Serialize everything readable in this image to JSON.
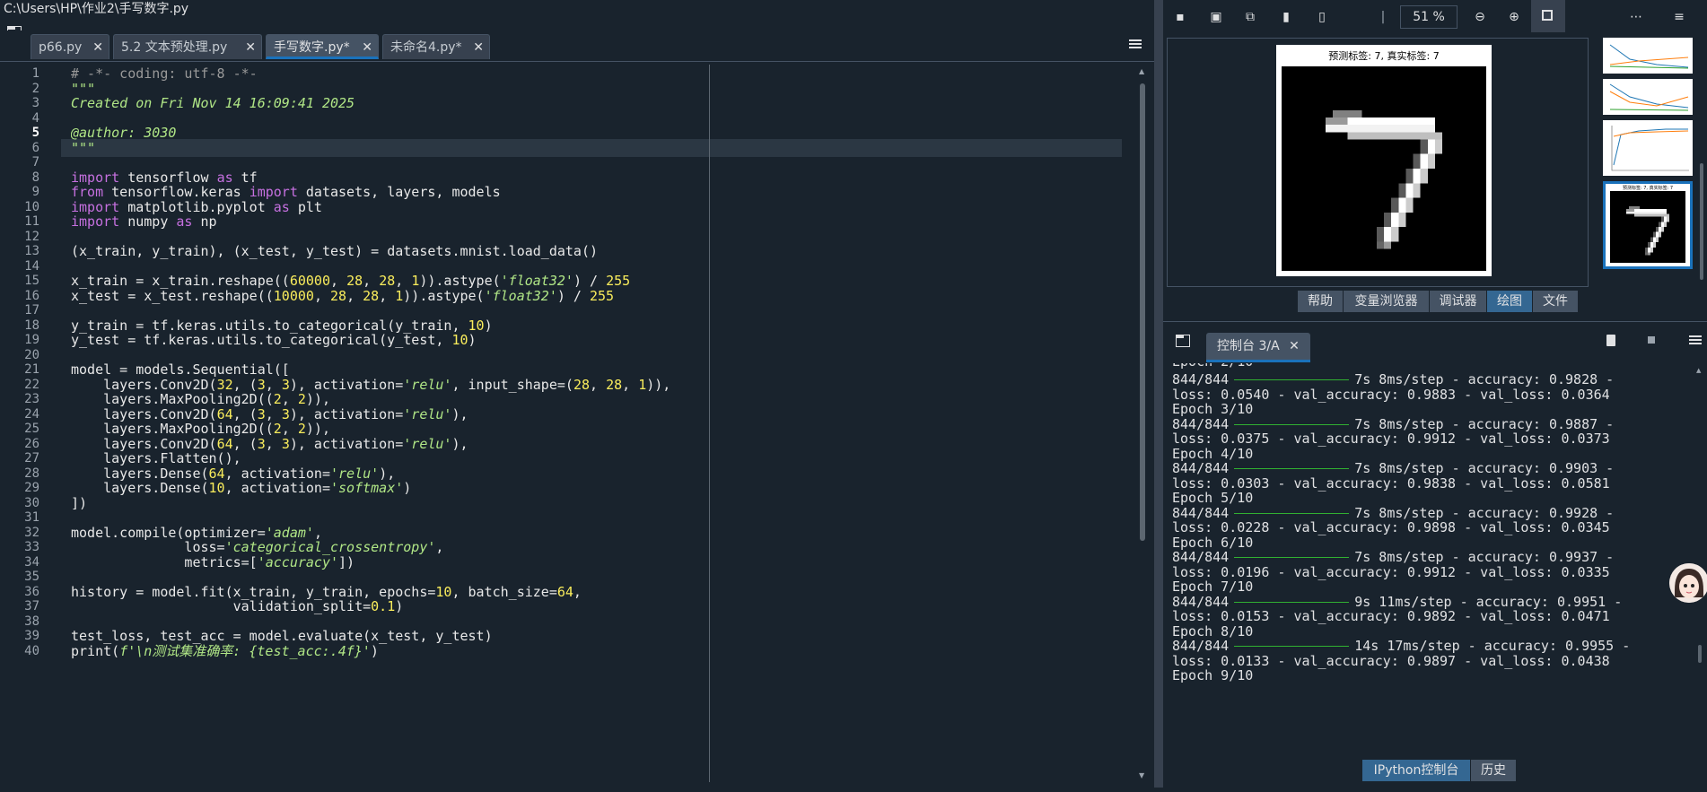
{
  "window": {
    "title": "C:\\Users\\HP\\作业2\\手写数字.py"
  },
  "editor_tabs": [
    {
      "label": "p66.py"
    },
    {
      "label": "5.2 文本预处理.py"
    },
    {
      "label": "手写数字.py*"
    },
    {
      "label": "未命名4.py*"
    }
  ],
  "editor": {
    "line_numbers": [
      "1",
      "2",
      "3",
      "4",
      "5",
      "6",
      "7",
      "8",
      "9",
      "10",
      "11",
      "12",
      "13",
      "14",
      "15",
      "16",
      "17",
      "18",
      "19",
      "20",
      "21",
      "22",
      "23",
      "24",
      "25",
      "26",
      "27",
      "28",
      "29",
      "30",
      "31",
      "32",
      "33",
      "34",
      "35",
      "36",
      "37",
      "38",
      "39",
      "40"
    ],
    "current_line": 5,
    "lines": [
      "# -*- coding: utf-8 -*-",
      "\"\"\"",
      "Created on Fri Nov 14 16:09:41 2025",
      "",
      "@author: 3030",
      "\"\"\"",
      "",
      "import tensorflow as tf",
      "from tensorflow.keras import datasets, layers, models",
      "import matplotlib.pyplot as plt",
      "import numpy as np",
      "",
      "(x_train, y_train), (x_test, y_test) = datasets.mnist.load_data()",
      "",
      "x_train = x_train.reshape((60000, 28, 28, 1)).astype('float32') / 255",
      "x_test = x_test.reshape((10000, 28, 28, 1)).astype('float32') / 255",
      "",
      "y_train = tf.keras.utils.to_categorical(y_train, 10)",
      "y_test = tf.keras.utils.to_categorical(y_test, 10)",
      "",
      "model = models.Sequential([",
      "    layers.Conv2D(32, (3, 3), activation='relu', input_shape=(28, 28, 1)),",
      "    layers.MaxPooling2D((2, 2)),",
      "    layers.Conv2D(64, (3, 3), activation='relu'),",
      "    layers.MaxPooling2D((2, 2)),",
      "    layers.Conv2D(64, (3, 3), activation='relu'),",
      "    layers.Flatten(),",
      "    layers.Dense(64, activation='relu'),",
      "    layers.Dense(10, activation='softmax')",
      "])",
      "",
      "model.compile(optimizer='adam',",
      "              loss='categorical_crossentropy',",
      "              metrics=['accuracy'])",
      "",
      "history = model.fit(x_train, y_train, epochs=10, batch_size=64,",
      "                    validation_split=0.1)",
      "",
      "test_loss, test_acc = model.evaluate(x_test, y_test)",
      "print(f'\\n测试集准确率: {test_acc:.4f}')"
    ]
  },
  "plots": {
    "zoom": "51 %",
    "title": "预测标签: 7, 真实标签: 7",
    "thumb_title": "预测标签: 7, 真实标签: 7"
  },
  "pane_tabs": [
    {
      "label": "帮助"
    },
    {
      "label": "变量浏览器"
    },
    {
      "label": "调试器"
    },
    {
      "label": "绘图",
      "selected": true
    },
    {
      "label": "文件"
    }
  ],
  "console": {
    "tab_label": "控制台 3/A",
    "top_partial": "Epoch 2/10",
    "lines": [
      {
        "type": "progress",
        "steps": "844/844",
        "stats": "7s 8ms/step - accuracy: 0.9828 -"
      },
      {
        "type": "text",
        "text": "loss: 0.0540 - val_accuracy: 0.9883 - val_loss: 0.0364"
      },
      {
        "type": "text",
        "text": "Epoch 3/10"
      },
      {
        "type": "progress",
        "steps": "844/844",
        "stats": "7s 8ms/step - accuracy: 0.9887 -"
      },
      {
        "type": "text",
        "text": "loss: 0.0375 - val_accuracy: 0.9912 - val_loss: 0.0373"
      },
      {
        "type": "text",
        "text": "Epoch 4/10"
      },
      {
        "type": "progress",
        "steps": "844/844",
        "stats": "7s 8ms/step - accuracy: 0.9903 -"
      },
      {
        "type": "text",
        "text": "loss: 0.0303 - val_accuracy: 0.9838 - val_loss: 0.0581"
      },
      {
        "type": "text",
        "text": "Epoch 5/10"
      },
      {
        "type": "progress",
        "steps": "844/844",
        "stats": "7s 8ms/step - accuracy: 0.9928 -"
      },
      {
        "type": "text",
        "text": "loss: 0.0228 - val_accuracy: 0.9898 - val_loss: 0.0345"
      },
      {
        "type": "text",
        "text": "Epoch 6/10"
      },
      {
        "type": "progress",
        "steps": "844/844",
        "stats": "7s 8ms/step - accuracy: 0.9937 -"
      },
      {
        "type": "text",
        "text": "loss: 0.0196 - val_accuracy: 0.9912 - val_loss: 0.0335"
      },
      {
        "type": "text",
        "text": "Epoch 7/10"
      },
      {
        "type": "progress",
        "steps": "844/844",
        "stats": "9s 11ms/step - accuracy: 0.9951 -"
      },
      {
        "type": "text",
        "text": "loss: 0.0153 - val_accuracy: 0.9892 - val_loss: 0.0471"
      },
      {
        "type": "text",
        "text": "Epoch 8/10"
      },
      {
        "type": "progress",
        "steps": "844/844",
        "stats": "14s 17ms/step - accuracy: 0.9955 -"
      },
      {
        "type": "text",
        "text": "loss: 0.0133 - val_accuracy: 0.9897 - val_loss: 0.0438"
      },
      {
        "type": "text",
        "text": "Epoch 9/10"
      }
    ]
  },
  "bottom_tabs": [
    {
      "label": "IPython控制台",
      "selected": true
    },
    {
      "label": "历史"
    }
  ],
  "colors": {
    "background": "#19232d",
    "keyword": "#c670e0",
    "number": "#faed5c",
    "string": "#b0e686",
    "progress": "#31b031",
    "accent": "#1a72bb",
    "selected_tab": "#346792"
  }
}
